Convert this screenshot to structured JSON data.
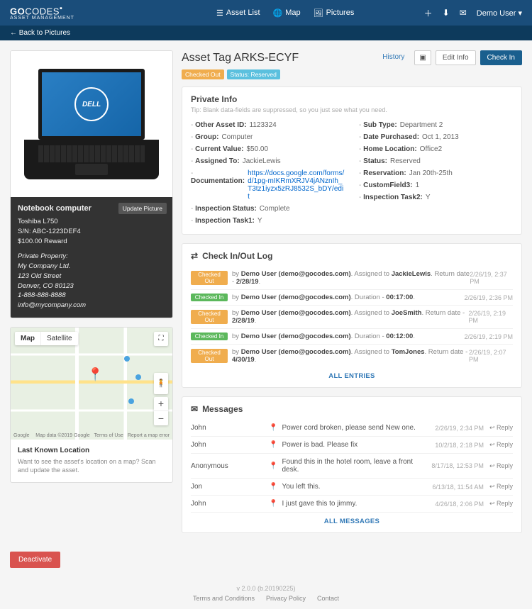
{
  "brand": {
    "name_go": "GO",
    "name_codes": "CODES",
    "sub": "ASSET MANAGEMENT"
  },
  "nav": {
    "asset_list": "Asset List",
    "map": "Map",
    "pictures": "Pictures"
  },
  "header": {
    "user": "Demo User"
  },
  "subbar": {
    "back": "Back to Pictures"
  },
  "asset_card": {
    "title": "Notebook computer",
    "update_btn": "Update Picture",
    "line1": "Toshiba L750",
    "line2": "S/N: ABC-1223DEF4",
    "line3": "$100.00 Reward",
    "p1": "Private Property:",
    "p2": "My Company Ltd.",
    "p3": "123 Old Street",
    "p4": "Denver, CO 80123",
    "p5": "1-888-888-8888",
    "p6": "info@mycompany.com"
  },
  "map": {
    "map_btn": "Map",
    "sat_btn": "Satellite",
    "google": "Google",
    "attr1": "Map data ©2019 Google",
    "attr2": "Terms of Use",
    "attr3": "Report a map error",
    "title": "Last Known Location",
    "desc": "Want to see the asset's location on a map? Scan and update the asset."
  },
  "title": "Asset Tag ARKS-ECYF",
  "badges": {
    "b1": "Checked Out",
    "b2": "Status: Reserved"
  },
  "actions": {
    "history": "History",
    "edit": "Edit Info",
    "checkin": "Check In"
  },
  "private": {
    "heading": "Private Info",
    "tip": "Tip: Blank data-fields are suppressed, so you just see what you need.",
    "left": [
      {
        "label": "Other Asset ID:",
        "val": "1123324"
      },
      {
        "label": "Group:",
        "val": "Computer"
      },
      {
        "label": "Current Value:",
        "val": "$50.00"
      },
      {
        "label": "Assigned To:",
        "val": "JackieLewis"
      },
      {
        "label": "Documentation:",
        "val": "https://docs.google.com/forms/d/1pg-mIKRmXRJV4jANznIh_T3tz1iyzx5zRJ8532S_bDY/edit",
        "link": true
      },
      {
        "label": "Inspection Status:",
        "val": "Complete"
      },
      {
        "label": "Inspection Task1:",
        "val": "Y"
      }
    ],
    "right": [
      {
        "label": "Sub Type:",
        "val": "Department 2"
      },
      {
        "label": "Date Purchased:",
        "val": "Oct 1, 2013"
      },
      {
        "label": "Home Location:",
        "val": "Office2"
      },
      {
        "label": "Status:",
        "val": "Reserved"
      },
      {
        "label": "Reservation:",
        "val": "Jan 20th-25th"
      },
      {
        "label": "CustomField3:",
        "val": "1"
      },
      {
        "label": "Inspection Task2:",
        "val": "Y"
      }
    ]
  },
  "log": {
    "heading": "Check In/Out Log",
    "rows": [
      {
        "badge": "Checked Out",
        "cls": "badge-warn",
        "user": "Demo User (demo@gocodes.com)",
        "midlabel": "Assigned to",
        "mid": "JackieLewis",
        "taillabel": "Return date -",
        "tail": "2/28/19",
        "time": "2/26/19, 2:37 PM"
      },
      {
        "badge": "Checked In",
        "cls": "badge-ok",
        "user": "Demo User (demo@gocodes.com)",
        "midlabel": "Duration -",
        "mid": "00:17:00",
        "taillabel": "",
        "tail": "",
        "time": "2/26/19, 2:36 PM"
      },
      {
        "badge": "Checked Out",
        "cls": "badge-warn",
        "user": "Demo User (demo@gocodes.com)",
        "midlabel": "Assigned to",
        "mid": "JoeSmith",
        "taillabel": "Return date -",
        "tail": "2/28/19",
        "time": "2/26/19, 2:19 PM"
      },
      {
        "badge": "Checked In",
        "cls": "badge-ok",
        "user": "Demo User (demo@gocodes.com)",
        "midlabel": "Duration -",
        "mid": "00:12:00",
        "taillabel": "",
        "tail": "",
        "time": "2/26/19, 2:19 PM"
      },
      {
        "badge": "Checked Out",
        "cls": "badge-warn",
        "user": "Demo User (demo@gocodes.com)",
        "midlabel": "Assigned to",
        "mid": "TomJones",
        "taillabel": "Return date -",
        "tail": "4/30/19",
        "time": "2/26/19, 2:07 PM"
      }
    ],
    "all": "ALL ENTRIES"
  },
  "messages": {
    "heading": "Messages",
    "rows": [
      {
        "name": "John",
        "body": "Power cord broken, please send New one.",
        "time": "2/26/19, 2:34 PM"
      },
      {
        "name": "John",
        "body": "Power is bad. Please fix",
        "time": "10/2/18, 2:18 PM"
      },
      {
        "name": "Anonymous",
        "body": "Found this in the hotel room, leave a front desk.",
        "time": "8/17/18, 12:53 PM"
      },
      {
        "name": "Jon",
        "body": "You left this.",
        "time": "6/13/18, 11:54 AM"
      },
      {
        "name": "John",
        "body": "I just gave this to jimmy.",
        "time": "4/26/18, 2:06 PM"
      }
    ],
    "reply": "Reply",
    "all": "ALL MESSAGES"
  },
  "deactivate": "Deactivate",
  "footer": {
    "ver": "v 2.0.0 (b.20190225)",
    "l1": "Terms and Conditions",
    "l2": "Privacy Policy",
    "l3": "Contact"
  }
}
